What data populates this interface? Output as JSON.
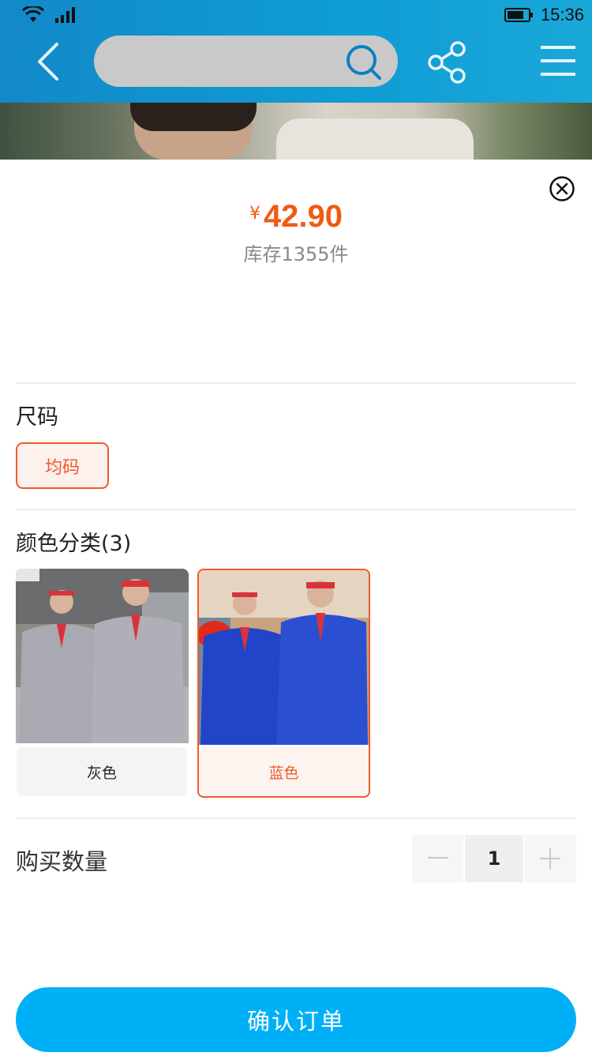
{
  "status_bar": {
    "time": "15:36"
  },
  "search": {
    "placeholder": ""
  },
  "product": {
    "currency": "¥",
    "price": "42.90",
    "stock_text": "库存1355件"
  },
  "size": {
    "title": "尺码",
    "options": [
      "均码"
    ],
    "selected": "均码"
  },
  "color": {
    "title": "颜色分类(3)",
    "options": [
      {
        "label": "灰色",
        "selected": false
      },
      {
        "label": "蓝色",
        "selected": true
      }
    ]
  },
  "quantity": {
    "label": "购买数量",
    "value": "1"
  },
  "confirm_label": "确认订单",
  "colors": {
    "accent": "#f05a2c",
    "price": "#f05a14",
    "confirm": "#00b0f6",
    "header": "#0f9bd4"
  },
  "icons": [
    "wifi-icon",
    "signal-icon",
    "battery-icon",
    "back-icon",
    "search-icon",
    "share-icon",
    "menu-icon",
    "close-icon",
    "minus-icon",
    "plus-icon"
  ]
}
